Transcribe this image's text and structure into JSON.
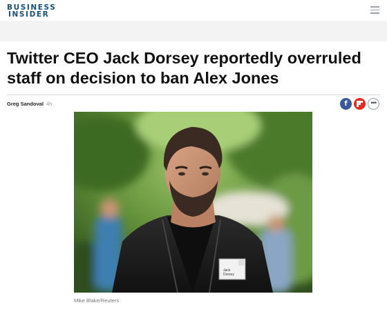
{
  "brand": {
    "line1": "BUSINESS",
    "line2": "INSIDER"
  },
  "article": {
    "headline": "Twitter CEO Jack Dorsey reportedly overruled staff on decision to ban Alex Jones",
    "author": "Greg Sandoval",
    "time_ago": "4h",
    "photo_credit": "Mike Blake/Reuters"
  },
  "share": {
    "facebook_glyph": "f",
    "more_glyph": "•••"
  },
  "photo": {
    "badge_text": "Jack Dorsey",
    "badge_corner": "SV"
  },
  "icons": [
    "menu-icon",
    "facebook-icon",
    "flipboard-icon",
    "more-icon"
  ],
  "colors": {
    "brand": "#1a4f7a",
    "facebook": "#3b5998",
    "flipboard": "#e62b1e"
  }
}
